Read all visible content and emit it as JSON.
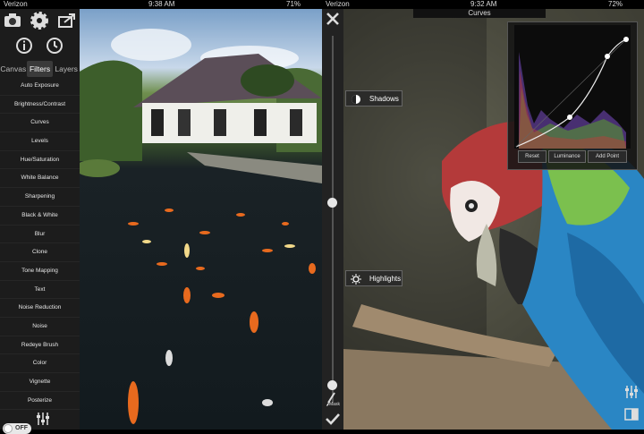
{
  "status_left": {
    "carrier": "Verizon",
    "time": "9:38 AM",
    "battery": "71%"
  },
  "status_right": {
    "carrier": "Verizon",
    "time": "9:32 AM",
    "battery": "72%"
  },
  "toolbar_icons": [
    "camera-icon",
    "gear-icon",
    "share-icon",
    "info-icon",
    "history-icon"
  ],
  "tabs": [
    {
      "label": "Canvas",
      "active": false
    },
    {
      "label": "Filters",
      "active": true
    },
    {
      "label": "Layers",
      "active": false
    }
  ],
  "filters": [
    "Auto Exposure",
    "Brightness/Contrast",
    "Curves",
    "Levels",
    "Hue/Saturation",
    "White Balance",
    "Sharpening",
    "Black & White",
    "Blur",
    "Clone",
    "Tone Mapping",
    "Text",
    "Noise Reduction",
    "Noise",
    "Redeye Brush",
    "Color",
    "Vignette",
    "Posterize"
  ],
  "toggle": {
    "label": "OFF",
    "value": false
  },
  "slider_strip": {
    "mask_label": "Mask",
    "close_icon": "close-icon",
    "confirm_icon": "checkmark-icon",
    "brush_icon": "brush-icon"
  },
  "right": {
    "title": "Curves",
    "shadows_label": "Shadows",
    "highlights_label": "Highlights",
    "curve_buttons": {
      "reset": "Reset",
      "luminance": "Luminance",
      "add_point": "Add Point"
    }
  },
  "colors": {
    "sidebar_bg": "#1c1c1c",
    "panel_bg": "#141414",
    "accent": "#e6e6e6"
  }
}
